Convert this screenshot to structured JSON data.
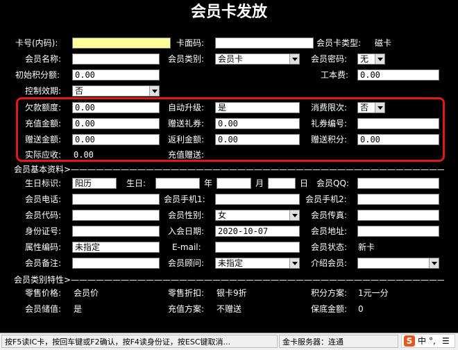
{
  "title": "会员卡发放",
  "rows": {
    "card_no_label": "卡号(内码):",
    "card_face_label": "卡面码:",
    "card_type_label": "会员卡类型:",
    "card_type_value": "磁卡",
    "member_name_label": "会员名称:",
    "member_cat_label": "会员类别:",
    "member_cat_value": "会员卡",
    "member_pwd_label": "会员密码:",
    "member_pwd_value": "无",
    "init_points_label": "初始积分额:",
    "init_points_value": "0.00",
    "fee_label": "工本费:",
    "fee_value": "0.00",
    "ctrl_valid_label": "控制效期:",
    "ctrl_valid_value": "否"
  },
  "boxed": {
    "debt_label": "欠款额度:",
    "debt_value": "0.00",
    "auto_upgrade_label": "自动升级:",
    "auto_upgrade_value": "是",
    "consume_limit_label": "消费限次:",
    "consume_limit_value": "否",
    "recharge_label": "充值金额:",
    "recharge_value": "0.00",
    "gift_coupon_label": "赠送礼券:",
    "gift_coupon_value": "0.00",
    "coupon_no_label": "礼券编号:",
    "gift_amount_label": "赠送金额:",
    "gift_amount_value": "0.00",
    "rebate_label": "返利金额:",
    "rebate_value": "0.00",
    "gift_points_label": "赠送积分:",
    "gift_points_value": "0.00",
    "actual_label": "实际应收:",
    "actual_value": "0.00",
    "recharge_gift_label": "充值赠送:"
  },
  "basic": {
    "section": "会员基本资料>——————————————————————————————————————————————————————————",
    "birth_mark_label": "生日标识:",
    "birth_mark_value": "阳历",
    "birthday_label": "生日:",
    "year": "年",
    "month": "月",
    "day": "日",
    "qq_label": "会员QQ:",
    "phone_label": "会员电话:",
    "mobile1_label": "会员手机1:",
    "mobile2_label": "会员手机2:",
    "code_label": "会员代码:",
    "gender_label": "会员性别:",
    "gender_value": "女",
    "fax_label": "会员传真:",
    "id_label": "身份证号:",
    "join_date_label": "入会日期:",
    "join_date_value": "2020-10-07",
    "address_label": "会员地址:",
    "attr_code_label": "属性编码:",
    "attr_code_value": "未指定",
    "email_label": "E-mail:",
    "status_label": "会员状态:",
    "status_value": "新卡",
    "remark_label": "会员备注:",
    "advisor_label": "会员顾问:",
    "advisor_value": "未指定",
    "introducer_label": "介绍会员:"
  },
  "category": {
    "section": "会员类别特性>——————————————————————————————————————————————————————————",
    "retail_price_label": "零售价格:",
    "retail_price_value": "会员价",
    "retail_discount_label": "零售折扣:",
    "retail_discount_value": "银卡9折",
    "points_plan_label": "积分方案:",
    "points_plan_value": "1元一分",
    "stored_label": "会员储值:",
    "stored_value": "是",
    "recharge_plan_label": "充值方案:",
    "recharge_plan_value": "不赠送",
    "guarantee_label": "保底金额:",
    "guarantee_value": "0"
  },
  "status_bar": {
    "hint": "按F5读IC卡，按回车键或F2确认，按F4读身份证，按ESC键取消...",
    "server": "金卡服务器：连通"
  },
  "ime": {
    "lang": "中",
    "punct": "°,"
  }
}
